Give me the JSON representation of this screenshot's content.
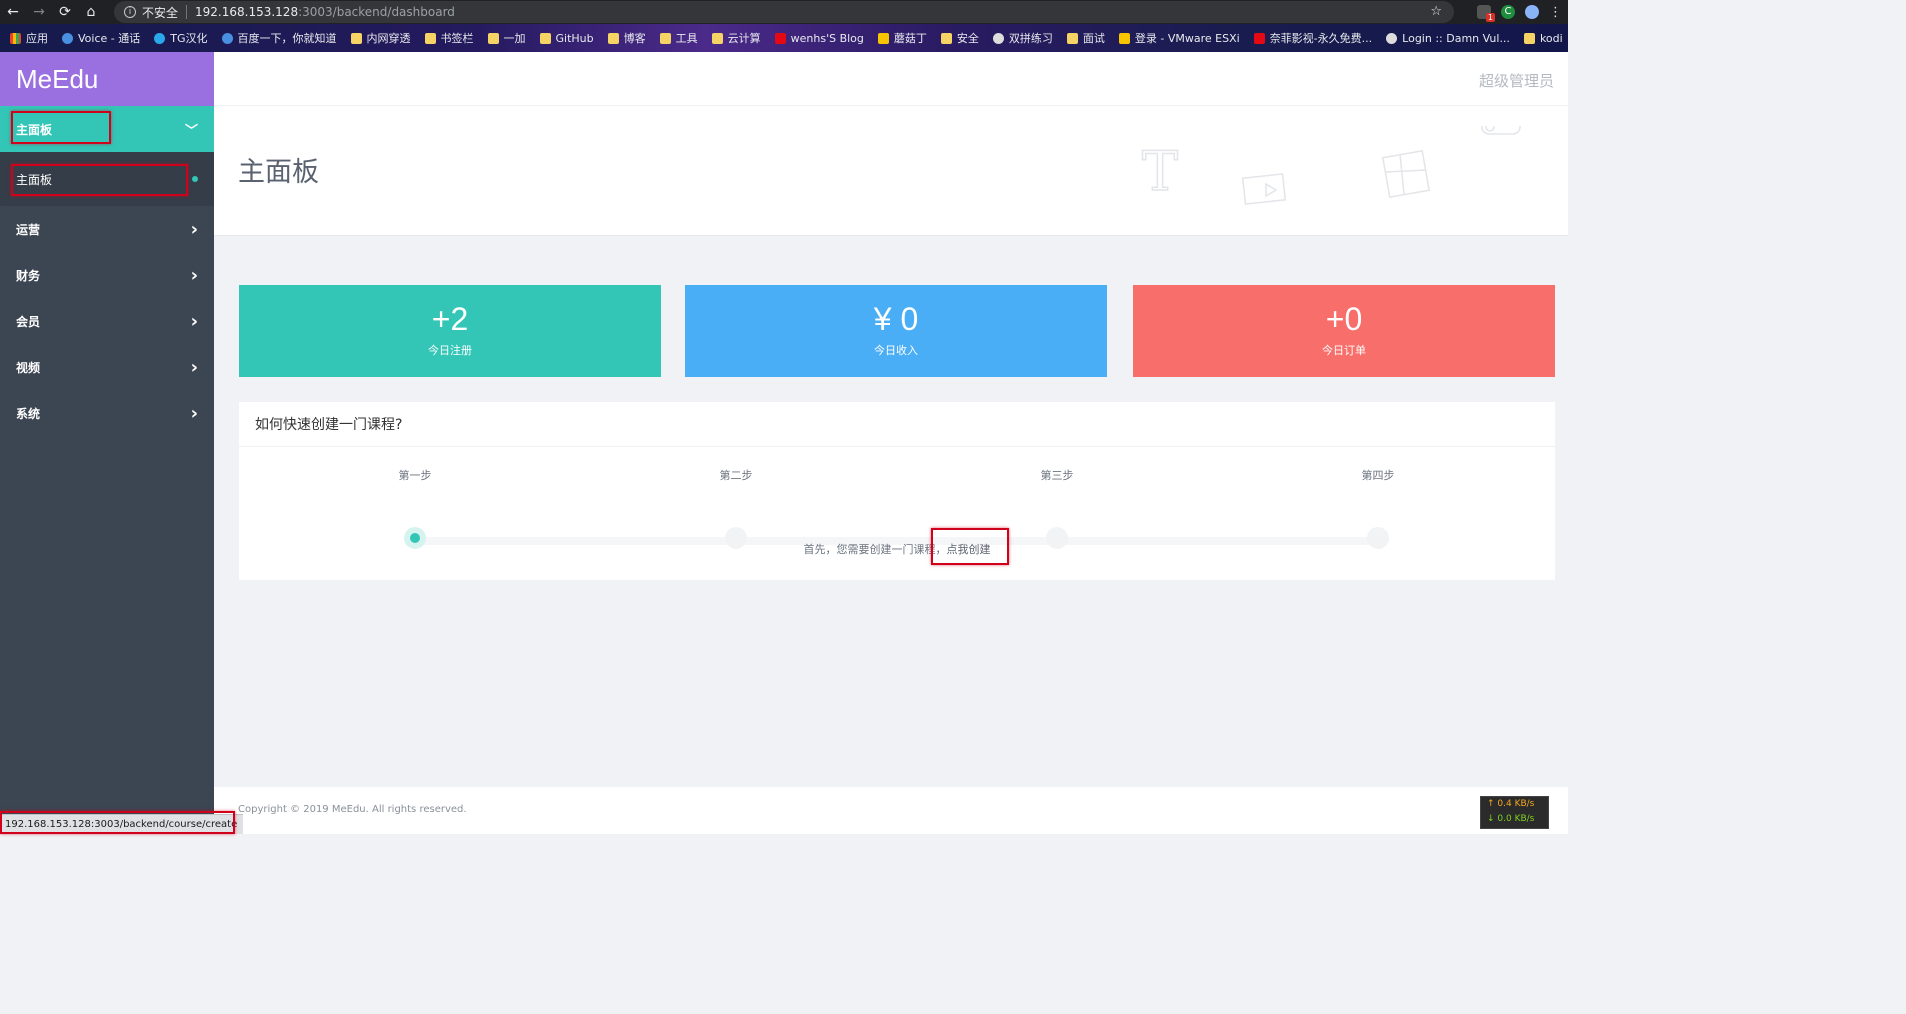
{
  "browser": {
    "security_label": "不安全",
    "url_host": "192.168.153.128",
    "url_path": ":3003/backend/dashboard",
    "status_url": "192.168.153.128:3003/backend/course/create",
    "net_up": "↑ 0.4 KB/s",
    "net_down": "↓ 0.0 KB/s",
    "ext_badge": "1",
    "bookmarks": [
      "应用",
      "Voice - 通话",
      "TG汉化",
      "百度一下，你就知道",
      "内网穿透",
      "书签栏",
      "一加",
      "GitHub",
      "博客",
      "工具",
      "云计算",
      "wenhs'S Blog",
      "蘑菇丁",
      "安全",
      "双拼练习",
      "面试",
      "登录 - VMware ESXi",
      "奈菲影视-永久免费...",
      "Login :: Damn Vul...",
      "kodi"
    ]
  },
  "app": {
    "brand": "MeEdu",
    "admin_label": "超级管理员",
    "page_title": "主面板",
    "copyright": "Copyright © 2019 MeEdu. All rights reserved."
  },
  "sidebar": {
    "active_group": "主面板",
    "active_item": "主面板",
    "groups": [
      "运营",
      "财务",
      "会员",
      "视频",
      "系统"
    ]
  },
  "stats": [
    {
      "value": "+2",
      "label": "今日注册",
      "color": "#33c5b6"
    },
    {
      "value": "¥ 0",
      "label": "今日收入",
      "color": "#4aaef6"
    },
    {
      "value": "+0",
      "label": "今日订单",
      "color": "#f76e6a"
    }
  ],
  "guide": {
    "title": "如何快速创建一门课程?",
    "steps": [
      "第一步",
      "第二步",
      "第三步",
      "第四步"
    ],
    "current_step": 1,
    "text_prefix": "首先，您需要创建一门课程，",
    "link_label": "点我创建"
  }
}
